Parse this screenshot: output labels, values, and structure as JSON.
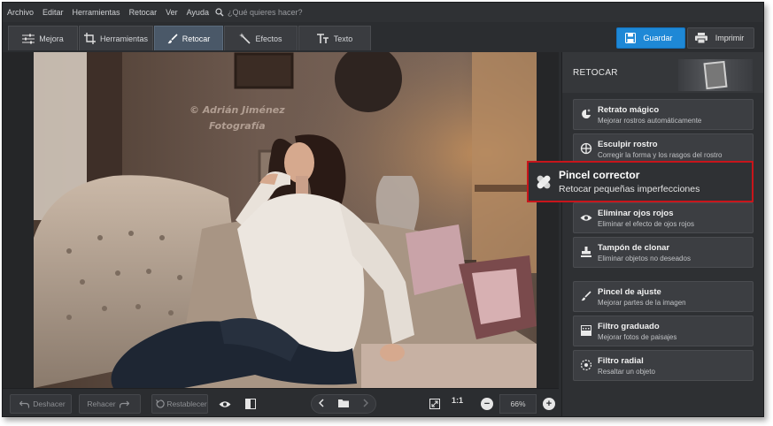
{
  "menu": {
    "items": [
      "Archivo",
      "Editar",
      "Herramientas",
      "Retocar",
      "Ver",
      "Ayuda"
    ],
    "search_placeholder": "¿Qué quieres hacer?"
  },
  "tabs": [
    {
      "label": "Mejora",
      "icon": "sliders-icon"
    },
    {
      "label": "Herramientas",
      "icon": "crop-icon"
    },
    {
      "label": "Retocar",
      "icon": "brush-icon",
      "active": true
    },
    {
      "label": "Efectos",
      "icon": "magic-wand-icon"
    },
    {
      "label": "Texto",
      "icon": "text-icon"
    }
  ],
  "actions": {
    "save_label": "Guardar",
    "print_label": "Imprimir"
  },
  "photo": {
    "watermark_line1": "© Adrián Jiménez",
    "watermark_line2": "Fotografía"
  },
  "bottombar": {
    "undo_label": "Deshacer",
    "redo_label": "Rehacer",
    "reset_label": "Restablecer",
    "zoom_1to1": "1:1",
    "zoom_value": "66%"
  },
  "panel": {
    "title": "RETOCAR",
    "tools": [
      {
        "name": "Retrato mágico",
        "desc": "Mejorar rostros automáticamente",
        "icon": "face-magic-icon"
      },
      {
        "name": "Esculpir rostro",
        "desc": "Corregir la forma y los rasgos del rostro",
        "icon": "sculpt-icon"
      },
      {
        "name": "Pincel corrector",
        "desc": "Retocar pequeñas imperfecciones",
        "icon": "bandage-icon"
      },
      {
        "name": "Eliminar ojos rojos",
        "desc": "Eliminar el efecto de ojos rojos",
        "icon": "eye-icon"
      },
      {
        "name": "Tampón de clonar",
        "desc": "Eliminar objetos no deseados",
        "icon": "stamp-icon"
      },
      {
        "name": "Pincel de ajuste",
        "desc": "Mejorar partes de la imagen",
        "icon": "brush-icon"
      },
      {
        "name": "Filtro graduado",
        "desc": "Mejorar fotos de paisajes",
        "icon": "gradient-icon"
      },
      {
        "name": "Filtro radial",
        "desc": "Resaltar un objeto",
        "icon": "radial-icon"
      }
    ]
  },
  "colors": {
    "accent": "#1e88d6",
    "highlight_border": "#c8151b",
    "panel_bg": "#2e3033"
  }
}
